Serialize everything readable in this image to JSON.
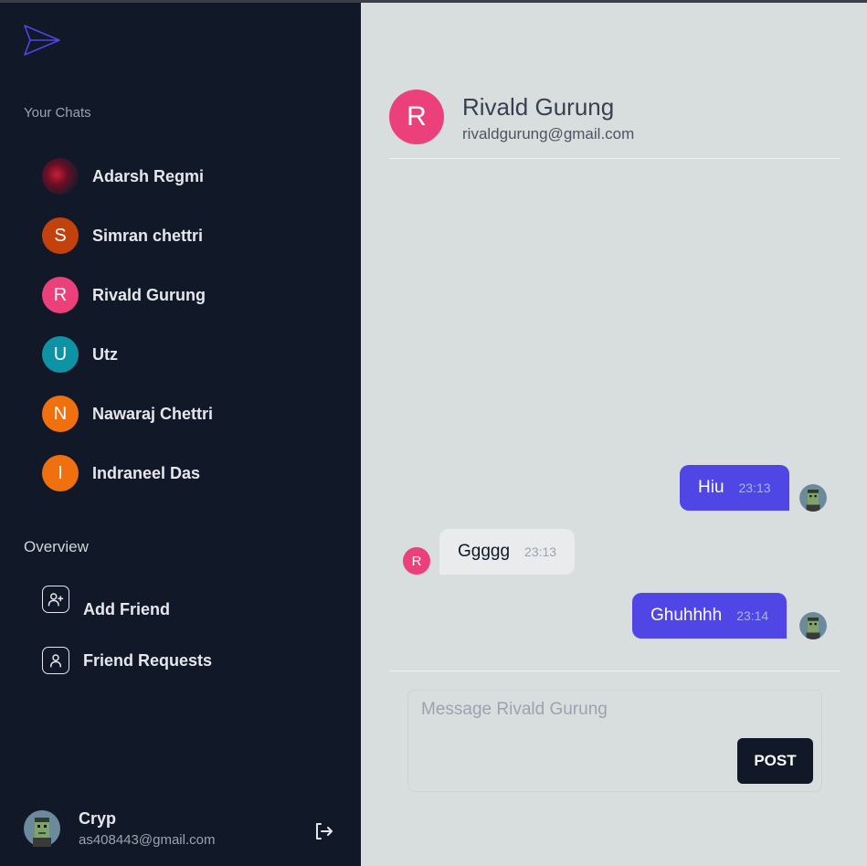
{
  "sidebar": {
    "chats_title": "Your Chats",
    "chats": [
      {
        "name": "Adarsh Regmi",
        "initial": "",
        "color": "#5a1020"
      },
      {
        "name": "Simran chettri",
        "initial": "S",
        "color": "#c2410c"
      },
      {
        "name": "Rivald Gurung",
        "initial": "R",
        "color": "#ec407a"
      },
      {
        "name": "Utz",
        "initial": "U",
        "color": "#0e93a4"
      },
      {
        "name": "Nawaraj Chettri",
        "initial": "N",
        "color": "#f07010"
      },
      {
        "name": "Indraneel Das",
        "initial": "I",
        "color": "#f07010"
      }
    ],
    "overview_title": "Overview",
    "overview": [
      {
        "label": "Add Friend",
        "icon": "add-user-icon"
      },
      {
        "label": "Friend Requests",
        "icon": "user-icon"
      }
    ],
    "user": {
      "name": "Cryp",
      "email": "as408443@gmail.com"
    }
  },
  "chat": {
    "name": "Rivald Gurung",
    "email": "rivaldgurung@gmail.com",
    "initial": "R",
    "messages": [
      {
        "text": "Hiu",
        "time": "23:13",
        "from": "me"
      },
      {
        "text": "Ggggg",
        "time": "23:13",
        "from": "them"
      },
      {
        "text": "Ghuhhhh",
        "time": "23:14",
        "from": "me"
      }
    ],
    "composer": {
      "placeholder": "Message Rivald Gurung",
      "post_label": "POST"
    }
  },
  "colors": {
    "sidebar": "#111827",
    "accent": "#4f46e5",
    "main_bg": "#d8dedd"
  }
}
